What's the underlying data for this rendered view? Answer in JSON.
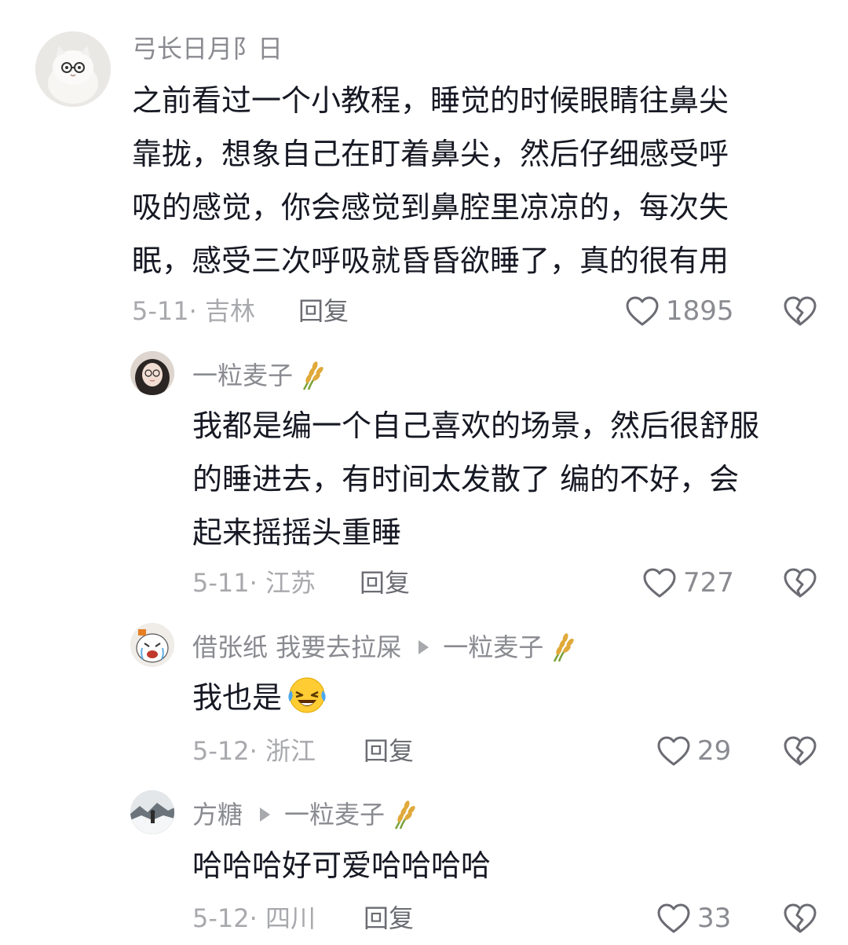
{
  "comments": [
    {
      "author": "弓长日月阝日",
      "lines": [
        "之前看过一个小教程，睡觉的时候眼睛往鼻尖",
        "靠拢，想象自己在盯着鼻尖，然后仔细感受呼",
        "吸的感觉，你会感觉到鼻腔里凉凉的，每次失",
        "眠，感受三次呼吸就昏昏欲睡了，真的很有用"
      ],
      "date_location": "5-11· 吉林",
      "reply_label": "回复",
      "likes": "1895",
      "avatar_icon": "cat-with-glasses-avatar"
    },
    {
      "author": "一粒麦子",
      "author_badge_icon": "wheat-icon",
      "lines": [
        "我都是编一个自己喜欢的场景，然后很舒服",
        "的睡进去，有时间太发散了 编的不好，会",
        "起来摇摇头重睡"
      ],
      "date_location": "5-11· 江苏",
      "reply_label": "回复",
      "likes": "727",
      "avatar_icon": "girl-with-glasses-avatar"
    },
    {
      "author": "借张纸 我要去拉屎",
      "reply_to": "一粒麦子",
      "reply_to_badge_icon": "wheat-icon",
      "text": "我也是",
      "text_emoji_icon": "laughing-crying-emoji",
      "date_location": "5-12· 浙江",
      "reply_label": "回复",
      "likes": "29",
      "avatar_icon": "crying-cartoon-avatar"
    },
    {
      "author": "方糖",
      "reply_to": "一粒麦子",
      "reply_to_badge_icon": "wheat-icon",
      "text": "哈哈哈好可爱哈哈哈哈",
      "date_location": "5-12· 四川",
      "reply_label": "回复",
      "likes": "33",
      "avatar_icon": "snowy-landscape-avatar"
    }
  ],
  "icons": {
    "like": "heart-outline-icon",
    "dislike": "broken-heart-icon"
  },
  "colors": {
    "text_primary": "#161823",
    "text_secondary": "#8a8b91",
    "text_meta": "#a8a9ad",
    "background": "#ffffff"
  }
}
